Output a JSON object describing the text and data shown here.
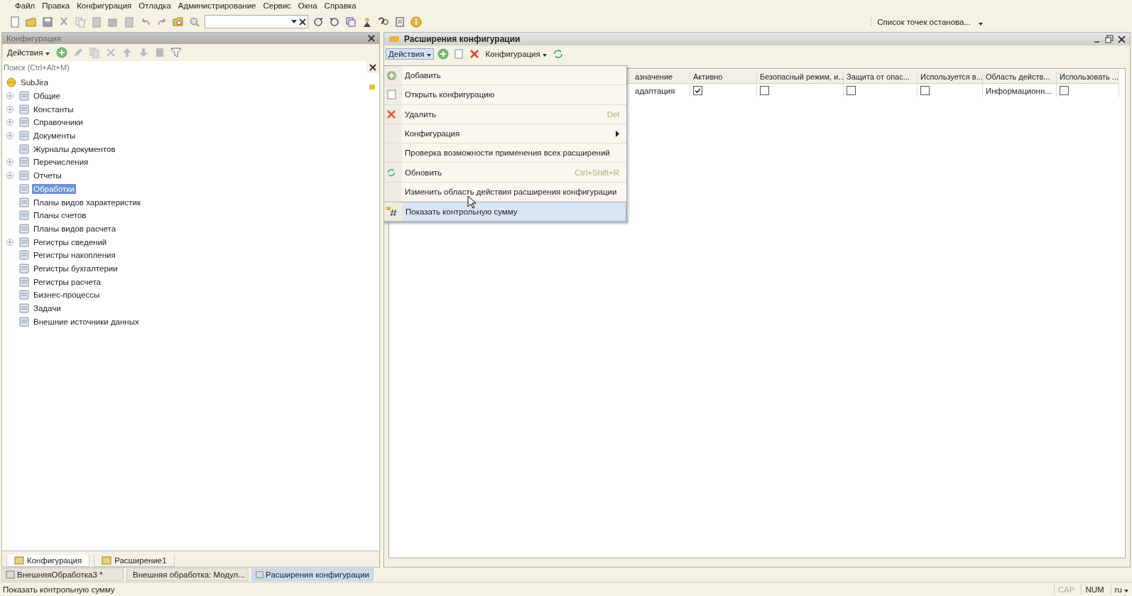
{
  "menu_bar": [
    "Файл",
    "Правка",
    "Конфигурация",
    "Отладка",
    "Администрирование",
    "Сервис",
    "Окна",
    "Справка"
  ],
  "toolbar": {
    "breakpoints": "Список точек останова..."
  },
  "config_panel": {
    "title": "Конфигурация",
    "actions": "Действия",
    "search": {
      "placeholder": "Поиск (Ctrl+Alt+M)"
    },
    "tree": [
      {
        "label": "SubJira",
        "selected": false,
        "children": [
          {
            "label": "Общие",
            "expandable": true,
            "selected": false
          },
          {
            "label": "Константы",
            "expandable": true,
            "selected": false
          },
          {
            "label": "Справочники",
            "expandable": true,
            "selected": false
          },
          {
            "label": "Документы",
            "expandable": true,
            "selected": false
          },
          {
            "label": "Журналы документов",
            "expandable": false,
            "selected": false
          },
          {
            "label": "Перечисления",
            "expandable": true,
            "selected": false
          },
          {
            "label": "Отчеты",
            "expandable": true,
            "selected": false
          },
          {
            "label": "Обработки",
            "expandable": false,
            "selected": true
          },
          {
            "label": "Планы видов характеристик",
            "expandable": false,
            "selected": false
          },
          {
            "label": "Планы счетов",
            "expandable": false,
            "selected": false
          },
          {
            "label": "Планы видов расчета",
            "expandable": false,
            "selected": false
          },
          {
            "label": "Регистры сведений",
            "expandable": true,
            "selected": false
          },
          {
            "label": "Регистры накопления",
            "expandable": false,
            "selected": false
          },
          {
            "label": "Регистры бухгалтерии",
            "expandable": false,
            "selected": false
          },
          {
            "label": "Регистры расчета",
            "expandable": false,
            "selected": false
          },
          {
            "label": "Бизнес-процессы",
            "expandable": false,
            "selected": false
          },
          {
            "label": "Задачи",
            "expandable": false,
            "selected": false
          },
          {
            "label": "Внешние источники данных",
            "expandable": false,
            "selected": false
          }
        ]
      }
    ],
    "tabs": [
      {
        "label": "Конфигурация",
        "selected": true
      },
      {
        "label": "Расширение1",
        "selected": false
      }
    ]
  },
  "extensions_window": {
    "title": "Расширения конфигурации",
    "actions": "Действия",
    "config_menu": "Конфигурация",
    "table": {
      "columns": [
        "азначение",
        "Активно",
        "Безопасный режим, и...",
        "Защита от опас...",
        "Используется в...",
        "Область действ...",
        "Использовать ..."
      ],
      "rows": [
        [
          {
            "kind": "text",
            "value": "адаптация"
          },
          {
            "kind": "check",
            "checked": true
          },
          {
            "kind": "check",
            "checked": false
          },
          {
            "kind": "check",
            "checked": false
          },
          {
            "kind": "check",
            "checked": false
          },
          {
            "kind": "text",
            "value": "Информационн..."
          },
          {
            "kind": "check",
            "checked": false
          }
        ]
      ]
    },
    "context_menu": [
      {
        "label": "Добавить",
        "submenu": false,
        "selected": false
      },
      {
        "label": "Открыть конфигурацию",
        "submenu": false,
        "selected": false
      },
      {
        "label": "Удалить",
        "shortcut": "Del",
        "submenu": false,
        "selected": false
      },
      {
        "label": "Конфигурация",
        "submenu": true,
        "selected": false
      },
      {
        "label": "Проверка возможности применения всех расширений",
        "submenu": false,
        "selected": false
      },
      {
        "label": "Обновить",
        "shortcut": "Ctrl+Shift+R",
        "submenu": false,
        "selected": false
      },
      {
        "label": "Изменить область действия расширения конфигурации",
        "submenu": false,
        "selected": false
      },
      {
        "label": "Показать контрольную сумму",
        "submenu": false,
        "selected": true
      }
    ]
  },
  "window_tabs": [
    {
      "label": "ВнешняяОбработка3 *",
      "selected": false
    },
    {
      "label": "Внешняя обработка: Модул...",
      "selected": false
    },
    {
      "label": "Расширения конфигурации",
      "selected": true
    }
  ],
  "status_bar": {
    "message": "Показать контрольную сумму",
    "indicators": [
      {
        "label": "CAP",
        "on": false
      },
      {
        "label": "NUM",
        "on": true
      }
    ],
    "language": "ru"
  }
}
